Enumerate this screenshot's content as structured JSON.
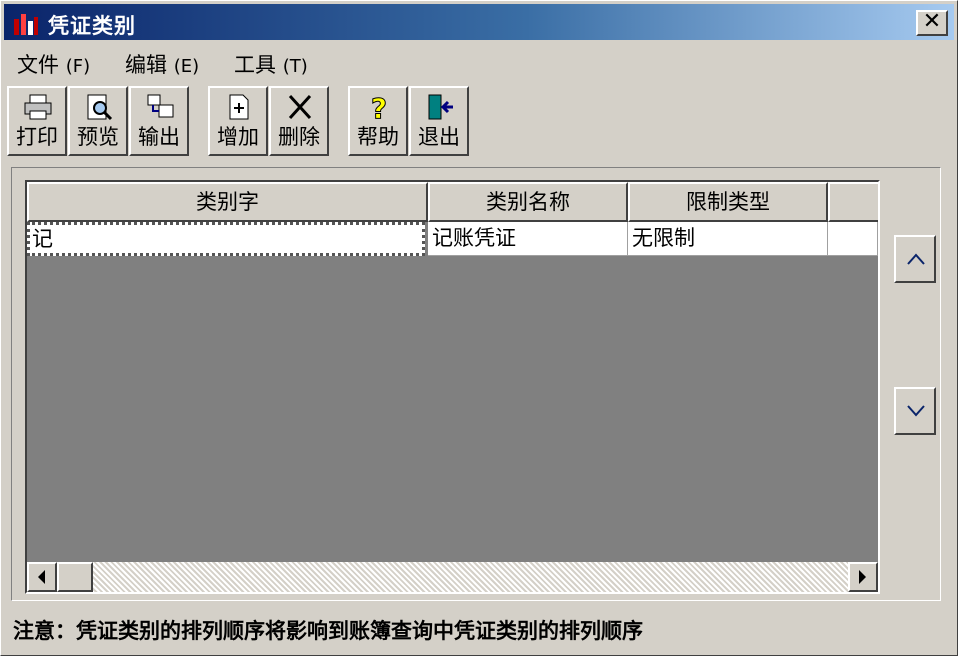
{
  "window": {
    "title": "凭证类别",
    "close_label": "✕"
  },
  "menu": [
    {
      "label": "文件",
      "key": "(F)"
    },
    {
      "label": "编辑",
      "key": "(E)"
    },
    {
      "label": "工具",
      "key": "(T)"
    }
  ],
  "toolbar": {
    "print": "打印",
    "preview": "预览",
    "export": "输出",
    "add": "增加",
    "delete": "删除",
    "help": "帮助",
    "exit": "退出"
  },
  "grid": {
    "columns": [
      "类别字",
      "类别名称",
      "限制类型"
    ],
    "rows": [
      {
        "code": "记",
        "name": "记账凭证",
        "limit": "无限制"
      }
    ]
  },
  "status": "注意：凭证类别的排列顺序将影响到账簿查询中凭证类别的排列顺序",
  "colors": {
    "title_start": "#0a246a",
    "title_end": "#a6caf0",
    "grid_bg": "#808080",
    "face": "#d4d0c8"
  }
}
